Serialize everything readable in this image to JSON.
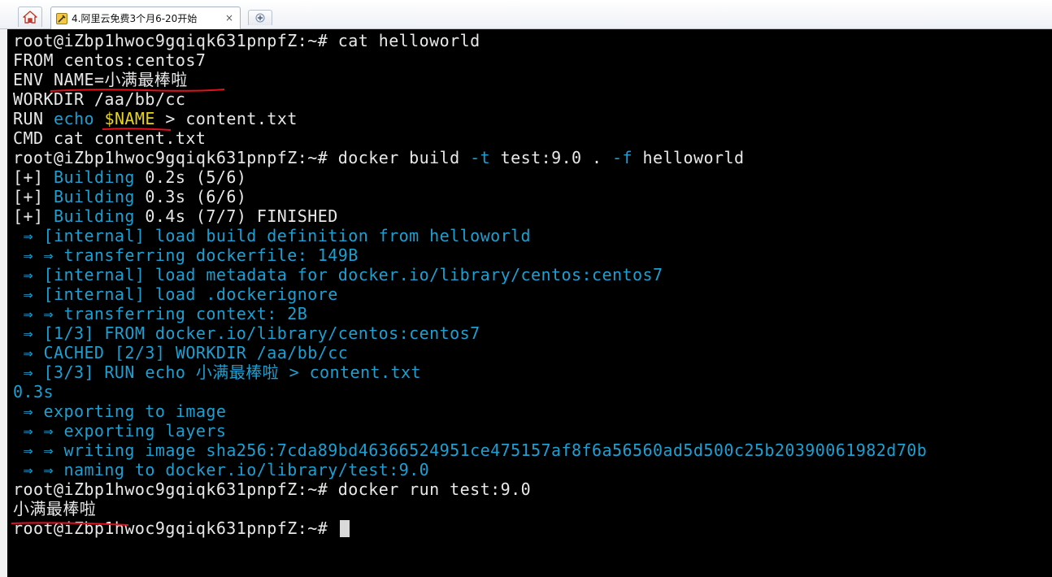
{
  "tabs": {
    "active_title": "4.阿里云免费3个月6-20开始",
    "close_glyph": "×",
    "home_icon": "home-icon",
    "new_tab_icon": "new-tab-icon"
  },
  "colors": {
    "background": "#000000",
    "text": "#e8e8e8",
    "blue": "#1e9fd2",
    "yellow": "#e6d322",
    "annotation": "#e0121e"
  },
  "terminal": {
    "prompt": "root@iZbp1hwoc9gqiqk631pnpfZ:~#",
    "commands": {
      "cat": "cat helloworld",
      "build": "docker build",
      "build_flag_t": "-t",
      "build_tag": "test:9.0 .",
      "build_flag_f": "-f",
      "build_file": "helloworld",
      "run": "docker run test:9.0"
    },
    "dockerfile": {
      "from": "FROM centos:centos7",
      "env_key": "ENV",
      "env_value": "NAME=小满最棒啦",
      "workdir": "WORKDIR /aa/bb/cc",
      "run_prefix": "RUN",
      "run_echo": "echo",
      "run_var": "$NAME",
      "run_suffix": "> content.txt",
      "cmd": "CMD cat content.txt"
    },
    "build_progress": [
      {
        "prefix": "[+]",
        "label": "Building",
        "rest": "0.2s (5/6)"
      },
      {
        "prefix": "[+]",
        "label": "Building",
        "rest": "0.3s (6/6)"
      },
      {
        "prefix": "[+]",
        "label": "Building",
        "rest": "0.4s (7/7) FINISHED"
      }
    ],
    "steps": [
      "⇒ [internal] load build definition from helloworld",
      "⇒ ⇒ transferring dockerfile: 149B",
      "⇒ [internal] load metadata for docker.io/library/centos:centos7",
      "⇒ [internal] load .dockerignore",
      "⇒ ⇒ transferring context: 2B",
      "⇒ [1/3] FROM docker.io/library/centos:centos7",
      "⇒ CACHED [2/3] WORKDIR /aa/bb/cc",
      "⇒ [3/3] RUN echo 小满最棒啦 > content.txt"
    ],
    "step_time": "0.3s",
    "export_steps": [
      "⇒ exporting to image",
      "⇒ ⇒ exporting layers",
      "⇒ ⇒ writing image sha256:7cda89bd46366524951ce475157af8f6a56560ad5d500c25b20390061982d70b",
      "⇒ ⇒ naming to docker.io/library/test:9.0"
    ],
    "run_output": "小满最棒啦"
  }
}
